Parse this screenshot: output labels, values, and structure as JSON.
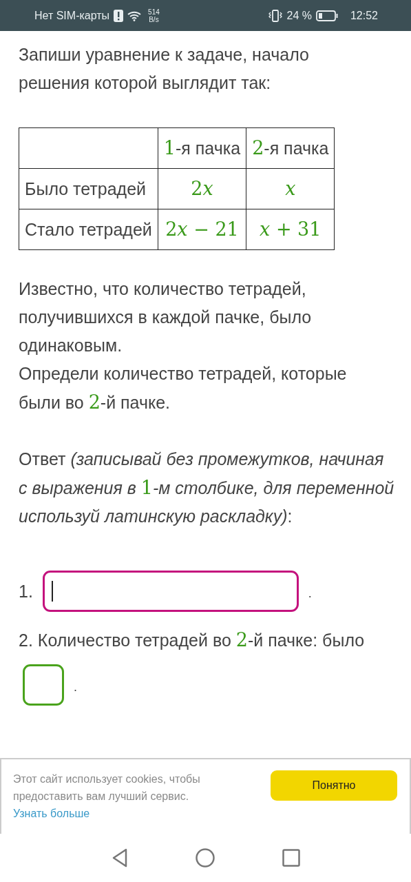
{
  "status_bar": {
    "carrier": "Нет SIM-карты",
    "speed_value": "514",
    "speed_unit": "B/s",
    "battery": "24 %",
    "time": "12:52"
  },
  "intro": [
    {
      "kind": "plain",
      "t": "Запиши уравнение к задаче, начало решения которой выглядит так:"
    }
  ],
  "table": {
    "header": [
      [
        {
          "kind": "math",
          "t": "1"
        },
        {
          "kind": "plain",
          "t": "-я пачка"
        }
      ],
      [
        {
          "kind": "math",
          "t": "2"
        },
        {
          "kind": "plain",
          "t": "-я пачка"
        }
      ]
    ],
    "rows": [
      [
        [
          {
            "kind": "plain",
            "t": "Было тетрадей"
          }
        ],
        [
          {
            "kind": "math",
            "t": "2x"
          }
        ],
        [
          {
            "kind": "math",
            "t": "x"
          }
        ]
      ],
      [
        [
          {
            "kind": "plain",
            "t": "Стало тетрадей"
          }
        ],
        [
          {
            "kind": "math",
            "t": "2x − 21"
          }
        ],
        [
          {
            "kind": "math",
            "t": "x + 31"
          }
        ]
      ]
    ]
  },
  "paragraphs": [
    [
      {
        "kind": "plain",
        "t": "Известно, что количество тетрадей, получившихся в каждой пачке, было одинаковым."
      }
    ],
    [
      {
        "kind": "plain",
        "t": "Определи количество тетрадей, которые были во "
      },
      {
        "kind": "math",
        "t": "2"
      },
      {
        "kind": "plain",
        "t": "-й пачке."
      }
    ]
  ],
  "answer_hint": [
    {
      "kind": "plain",
      "t": "Ответ "
    },
    {
      "kind": "italic",
      "t": "(записывай без промежутков, начиная с выражения в "
    },
    {
      "kind": "math",
      "t": "1"
    },
    {
      "kind": "italic",
      "t": "-м столбике, для переменной используй латинскую раскладку)"
    },
    {
      "kind": "plain",
      "t": ":"
    }
  ],
  "answers": [
    {
      "kind": "wide",
      "number": "1.",
      "focused": true,
      "end": "."
    },
    {
      "kind": "small",
      "number": "2.",
      "prompt": [
        {
          "kind": "plain",
          "t": "Количество тетрадей во "
        },
        {
          "kind": "math",
          "t": "2"
        },
        {
          "kind": "plain",
          "t": "-й пачке: было"
        }
      ],
      "focused": false,
      "end": "."
    }
  ],
  "cookie_banner": {
    "text": "Этот сайт использует cookies, чтобы предоставить вам лучший сервис.",
    "link": "Узнать больше",
    "button": "Понятно"
  }
}
